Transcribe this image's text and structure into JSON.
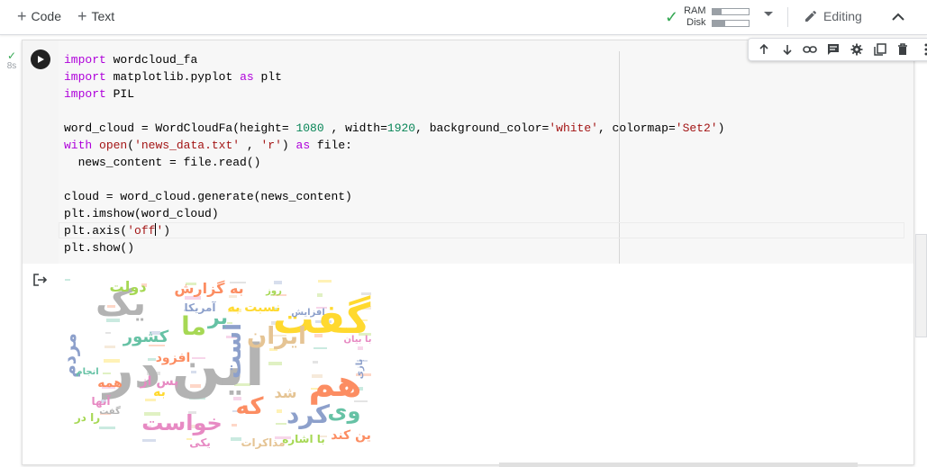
{
  "toolbar": {
    "add_code_label": "Code",
    "add_text_label": "Text",
    "ram_label": "RAM",
    "disk_label": "Disk",
    "ram_usage": 0.25,
    "disk_usage": 0.35,
    "mode_label": "Editing"
  },
  "cell": {
    "exec_time": "8s",
    "code_lines": [
      "import wordcloud_fa",
      "import matplotlib.pyplot as plt",
      "import PIL",
      "",
      "word_cloud = WordCloudFa(height= 1080 , width=1920, background_color='white', colormap='Set2')",
      "with open('news_data.txt' , 'r') as file:",
      "  news_content = file.read()",
      "",
      "cloud = word_cloud.generate(news_content)",
      "plt.imshow(word_cloud)",
      "plt.axis('off')",
      "plt.show()"
    ]
  },
  "output": {
    "image_description": "wordcloud",
    "words": [
      {
        "text": "این",
        "color": "#b3b3b3"
      },
      {
        "text": "در",
        "color": "#b3b3b3"
      },
      {
        "text": "گفت",
        "color": "#ffd92f"
      },
      {
        "text": "یک",
        "color": "#b3b3b3"
      },
      {
        "text": "هم",
        "color": "#fc8d62"
      },
      {
        "text": "ما",
        "color": "#a6d854"
      },
      {
        "text": "ایران",
        "color": "#e5c494"
      },
      {
        "text": "کرد",
        "color": "#8da0cb"
      },
      {
        "text": "که",
        "color": "#fc8d62"
      },
      {
        "text": "خواست",
        "color": "#e78ac3"
      },
      {
        "text": "وی",
        "color": "#66c2a5"
      },
      {
        "text": "کشور",
        "color": "#66c2a5"
      },
      {
        "text": "است",
        "color": "#8da0cb"
      },
      {
        "text": "شد",
        "color": "#e5c494"
      },
      {
        "text": "به گزارش",
        "color": "#fc8d62"
      },
      {
        "text": "دولت",
        "color": "#a6d854"
      },
      {
        "text": "آمریکا",
        "color": "#8da0cb"
      },
      {
        "text": "افزود",
        "color": "#fc8d62"
      },
      {
        "text": "پس از",
        "color": "#e78ac3"
      },
      {
        "text": "همه",
        "color": "#fc8d62"
      },
      {
        "text": "آنها",
        "color": "#e78ac3"
      },
      {
        "text": "مردم",
        "color": "#8da0cb"
      },
      {
        "text": "روز",
        "color": "#a6d854"
      },
      {
        "text": "نسبت به",
        "color": "#ffd92f"
      },
      {
        "text": "بر",
        "color": "#66c2a5"
      },
      {
        "text": "این کند",
        "color": "#fc8d62"
      },
      {
        "text": "را در",
        "color": "#a6d854"
      },
      {
        "text": "به",
        "color": "#ffd92f"
      },
      {
        "text": "افزایش",
        "color": "#8da0cb"
      },
      {
        "text": "با اشاره",
        "color": "#a6d854"
      },
      {
        "text": "مذاکرات",
        "color": "#e5c494"
      },
      {
        "text": "یکی",
        "color": "#e78ac3"
      },
      {
        "text": "انجام",
        "color": "#66c2a5"
      },
      {
        "text": "گفت",
        "color": "#b3b3b3"
      },
      {
        "text": "بازی",
        "color": "#8da0cb"
      },
      {
        "text": "با بیان",
        "color": "#e78ac3"
      }
    ]
  }
}
